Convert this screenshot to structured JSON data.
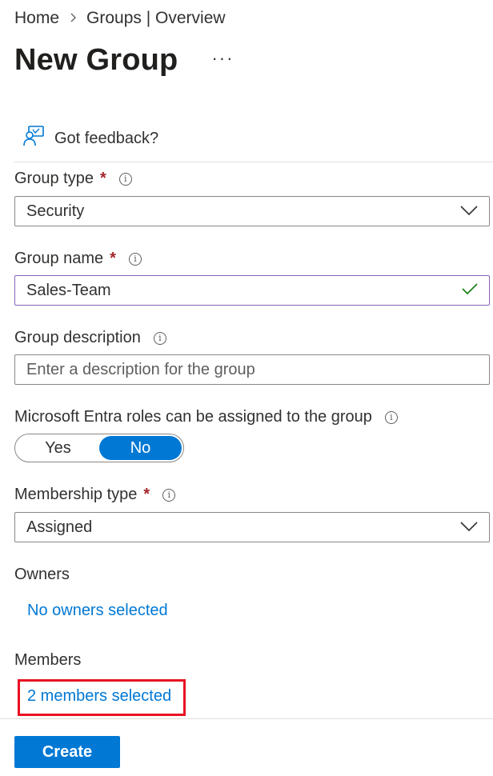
{
  "breadcrumb": {
    "home": "Home",
    "current": "Groups | Overview"
  },
  "page": {
    "title": "New Group",
    "more_label": "···"
  },
  "feedback": {
    "label": "Got feedback?"
  },
  "form": {
    "group_type": {
      "label": "Group type",
      "required_mark": "*",
      "value": "Security"
    },
    "group_name": {
      "label": "Group name",
      "required_mark": "*",
      "value": "Sales-Team"
    },
    "group_description": {
      "label": "Group description",
      "value": "",
      "placeholder": "Enter a description for the group"
    },
    "entra_roles": {
      "label": "Microsoft Entra roles can be assigned to the group",
      "options": [
        "Yes",
        "No"
      ],
      "selected": "No"
    },
    "membership_type": {
      "label": "Membership type",
      "required_mark": "*",
      "value": "Assigned"
    },
    "owners": {
      "label": "Owners",
      "link": "No owners selected"
    },
    "members": {
      "label": "Members",
      "link": "2 members selected"
    }
  },
  "actions": {
    "create_label": "Create"
  },
  "colors": {
    "accent": "#0078d4",
    "required": "#a4262c",
    "valid_check": "#107c10",
    "highlight": "#e81123"
  },
  "icons": [
    "chevron-right-icon",
    "more-icon",
    "feedback-icon",
    "info-icon",
    "chevron-down-icon",
    "checkmark-icon"
  ]
}
